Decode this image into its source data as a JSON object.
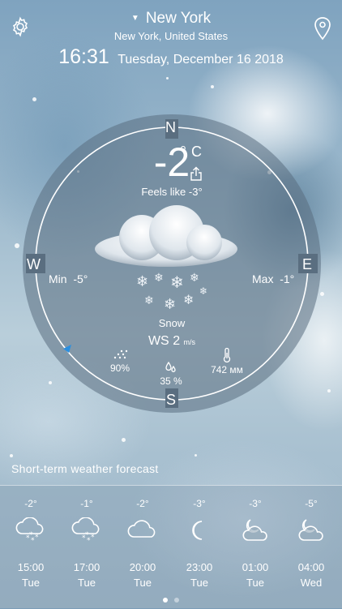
{
  "header": {
    "city": "New York",
    "region": "New York, United States",
    "time": "16:31",
    "date": "Tuesday, December 16 2018"
  },
  "current": {
    "temperature": "-2",
    "degree": "°",
    "unit": "C",
    "feels_like": "Feels like -3°",
    "min_label": "Min",
    "min_value": "-5°",
    "max_label": "Max",
    "max_value": "-1°",
    "condition": "Snow",
    "wind_label": "WS",
    "wind_value": "2",
    "wind_unit": "m/s",
    "precipitation": "90%",
    "humidity": "35 %",
    "pressure": "742 мм"
  },
  "compass": {
    "n": "N",
    "s": "S",
    "e": "E",
    "w": "W"
  },
  "forecast": {
    "title": "Short-term weather forecast",
    "items": [
      {
        "temp": "-2°",
        "icon": "snow-cloud-icon",
        "time": "15:00",
        "day": "Tue"
      },
      {
        "temp": "-1°",
        "icon": "snow-cloud-icon",
        "time": "17:00",
        "day": "Tue"
      },
      {
        "temp": "-2°",
        "icon": "cloud-icon",
        "time": "20:00",
        "day": "Tue"
      },
      {
        "temp": "-3°",
        "icon": "moon-icon",
        "time": "23:00",
        "day": "Tue"
      },
      {
        "temp": "-3°",
        "icon": "moon-cloud-icon",
        "time": "01:00",
        "day": "Tue"
      },
      {
        "temp": "-5°",
        "icon": "moon-cloud-icon",
        "time": "04:00",
        "day": "Wed"
      }
    ]
  },
  "pager": {
    "pages": 2,
    "active": 1
  }
}
